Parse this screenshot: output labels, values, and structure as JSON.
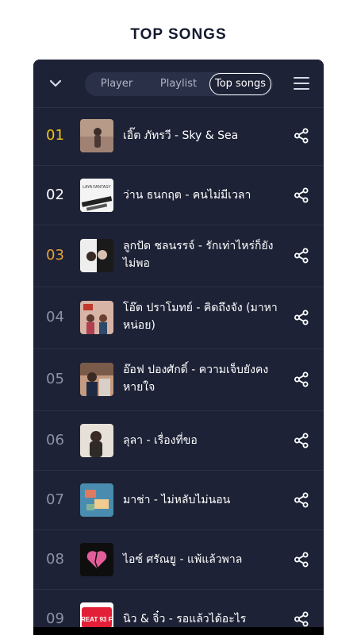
{
  "page": {
    "title": "TOP SONGS"
  },
  "tabs": [
    "Player",
    "Playlist",
    "Top songs"
  ],
  "colors": {
    "background": "#1d2236",
    "rank_gold": "#f0c41b",
    "rank_orange": "#e7a23b",
    "rank_default": "#8e92a4",
    "text": "#ffffff"
  },
  "songs": [
    {
      "rank": "01",
      "title": "เอิ๊ต ภัทรวี - Sky & Sea"
    },
    {
      "rank": "02",
      "title": "ว่าน ธนกฤต - คนไม่มีเวลา"
    },
    {
      "rank": "03",
      "title": "ลูกปัด ชลนรรจ์ - รักเท่าไหร่ก็ยังไม่พอ"
    },
    {
      "rank": "04",
      "title": "โอ๊ต ปราโมทย์ - คิดถึงจัง (มาหาหน่อย)"
    },
    {
      "rank": "05",
      "title": "อ๊อฟ ปองศักดิ์ - ความเจ็บยังคงหายใจ"
    },
    {
      "rank": "06",
      "title": "ลุลา - เรื่องที่ขอ"
    },
    {
      "rank": "07",
      "title": "มาช่า - ไม่หลับไม่นอน"
    },
    {
      "rank": "08",
      "title": "ไอซ์ ศรัณยู - แพ้แล้วพาล"
    },
    {
      "rank": "09",
      "title": "นิว & จิ๋ว - รอแล้วได้อะไร"
    }
  ],
  "thumb_text": {
    "02": "LAYA FANTASY",
    "09": "GREAT 93 FM"
  }
}
